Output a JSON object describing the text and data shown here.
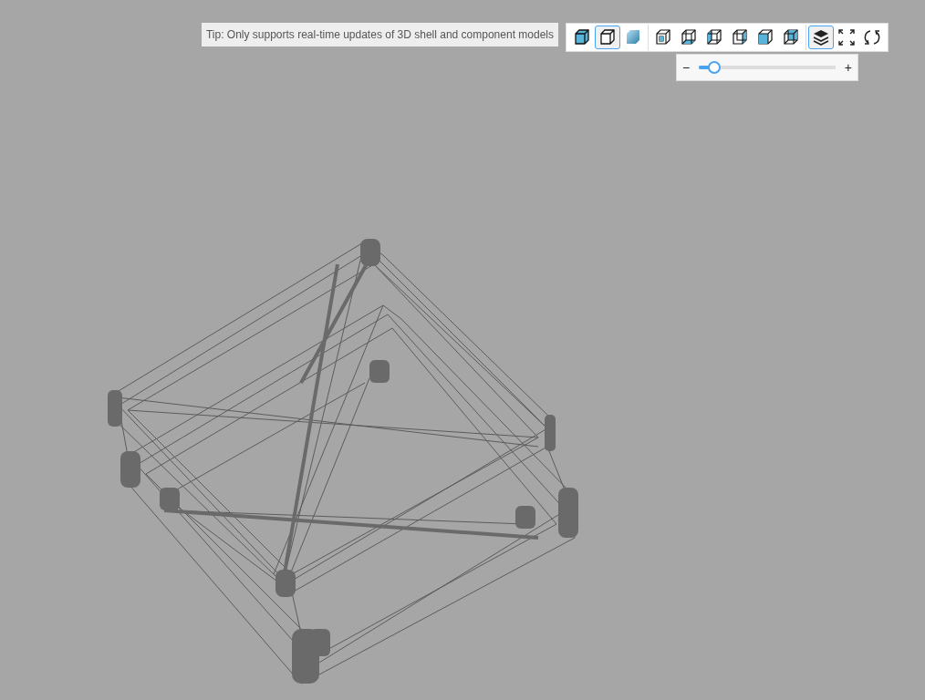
{
  "tip": "Tip: Only supports real-time updates of 3D shell and component models",
  "toolbar": [
    {
      "kind": "solid",
      "selected": false
    },
    {
      "kind": "wire",
      "selected": true
    },
    {
      "kind": "shaded",
      "selected": false
    },
    {
      "kind": "view-inner",
      "selected": false
    },
    {
      "kind": "view-bottom",
      "selected": false
    },
    {
      "kind": "view-left",
      "selected": false
    },
    {
      "kind": "view-right",
      "selected": false
    },
    {
      "kind": "view-front",
      "selected": false
    },
    {
      "kind": "view-back",
      "selected": false
    },
    {
      "kind": "layers",
      "selected": true
    },
    {
      "kind": "fullscreen",
      "selected": false
    },
    {
      "kind": "rotate",
      "selected": false
    }
  ],
  "slider": {
    "minus": "−",
    "plus": "+",
    "level": 0.1
  }
}
